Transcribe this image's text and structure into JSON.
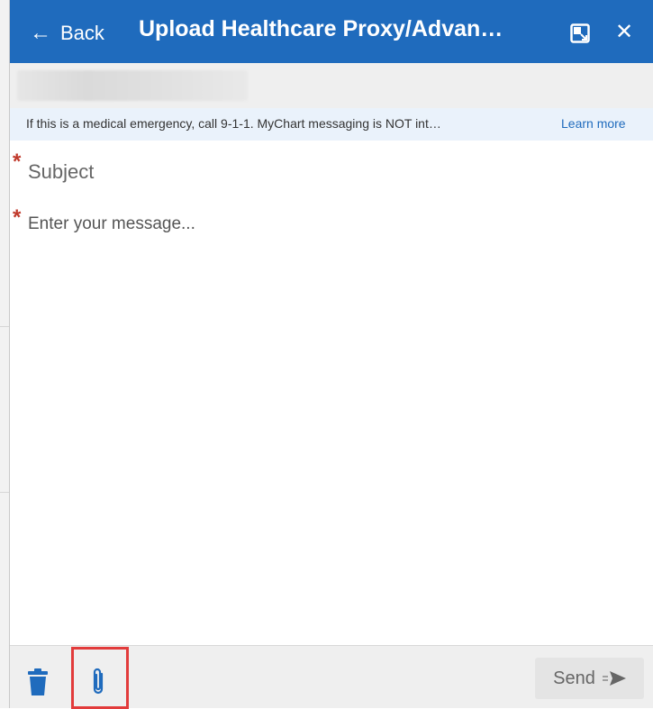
{
  "header": {
    "back_arrow_icon": "left-arrow-icon",
    "back_label": "Back",
    "title": "Upload Healthcare Proxy/Advan…",
    "popout_icon": "popout-icon",
    "close_icon": "close-icon",
    "close_glyph": "✕",
    "background_color": "#1f6bbd"
  },
  "notice": {
    "text": "If this is a medical emergency, call 9-1-1. MyChart messaging is NOT int…",
    "link_label": "Learn more"
  },
  "form": {
    "required_marker": "*",
    "subject_placeholder": "Subject",
    "message_placeholder": "Enter your message..."
  },
  "footer": {
    "delete_icon": "trash-icon",
    "attach_icon": "paperclip-icon",
    "send_label": "Send",
    "send_icon": "send-arrow-icon",
    "highlight_color": "#e23b3b"
  }
}
